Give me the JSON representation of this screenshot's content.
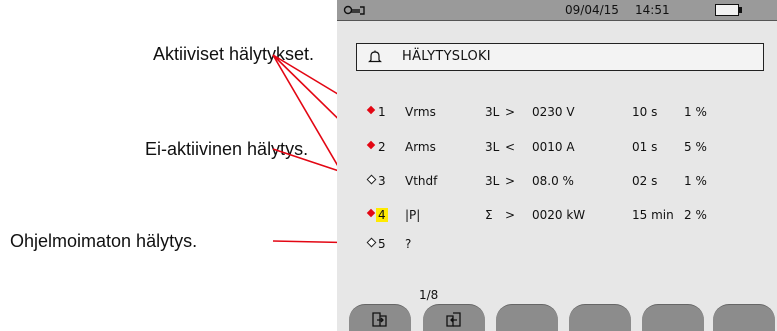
{
  "callouts": {
    "active": "Aktiiviset hälytykset.",
    "inactive": "Ei-aktiivinen hälytys.",
    "unprogrammed": "Ohjelmoimaton hälytys."
  },
  "status_bar": {
    "date": "09/04/15",
    "time": "14:51",
    "icon": "wrench-icon",
    "battery_icon": "battery-icon"
  },
  "title": {
    "icon": "bell-icon",
    "text": "HÄLYTYSLOKI"
  },
  "rows": [
    {
      "state": "active",
      "num": "1",
      "param": "Vrms",
      "phase": "3L",
      "cond": ">",
      "threshold": "0230 V",
      "duration": "10 s",
      "hyst": "1 %"
    },
    {
      "state": "active",
      "num": "2",
      "param": "Arms",
      "phase": "3L",
      "cond": "<",
      "threshold": "0010 A",
      "duration": "01 s",
      "hyst": "5 %"
    },
    {
      "state": "inactive",
      "num": "3",
      "param": "Vthdf",
      "phase": "3L",
      "cond": ">",
      "threshold": "08.0 %",
      "duration": "02 s",
      "hyst": "1 %"
    },
    {
      "state": "active",
      "num": "4",
      "param": "|P|",
      "phase": "Σ",
      "cond": ">",
      "threshold": "0020 kW",
      "duration": "15 min",
      "hyst": "2 %"
    },
    {
      "state": "inactive",
      "num": "5",
      "param": "?",
      "phase": "",
      "cond": "",
      "threshold": "",
      "duration": "",
      "hyst": ""
    }
  ],
  "page_indicator": "1/8",
  "softkeys": [
    "export-icon",
    "import-icon",
    "",
    "",
    "",
    ""
  ],
  "colors": {
    "active_marker": "#e30613",
    "highlight": "#ffea00",
    "screen_bg": "#e7e7e7",
    "status_bar": "#9a9a9a",
    "softkey": "#8c8c8c"
  }
}
